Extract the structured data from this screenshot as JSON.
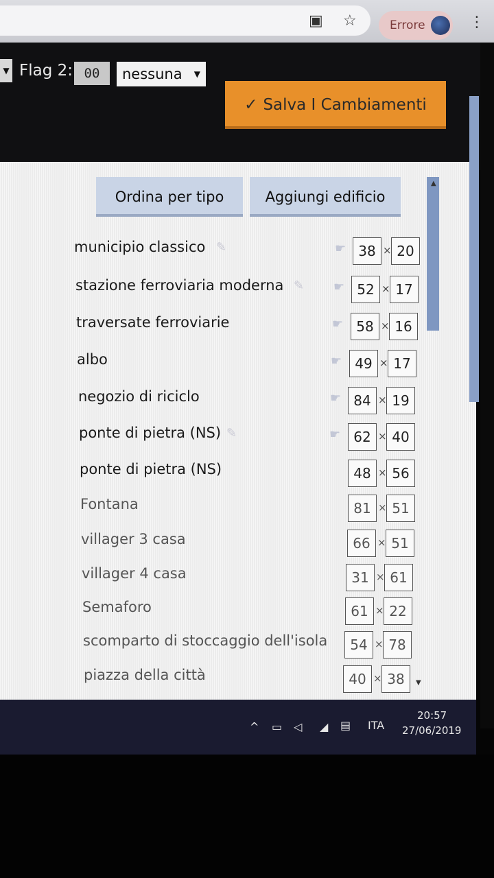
{
  "browser": {
    "error_label": "Errore"
  },
  "header": {
    "flag_label": "Flag 2:",
    "flag_code": "00",
    "flag_select_value": "nessuna",
    "save_button": "Salva I Cambiamenti"
  },
  "toolbar": {
    "sort_button": "Ordina per tipo",
    "add_button": "Aggiungi edificio"
  },
  "buildings": [
    {
      "name": "municipio classico",
      "w": "38",
      "h": "20"
    },
    {
      "name": "stazione ferroviaria moderna",
      "w": "52",
      "h": "17"
    },
    {
      "name": "traversate ferroviarie",
      "w": "58",
      "h": "16"
    },
    {
      "name": "albo",
      "w": "49",
      "h": "17"
    },
    {
      "name": "negozio di riciclo",
      "w": "84",
      "h": "19"
    },
    {
      "name": "ponte di pietra (NS)",
      "w": "62",
      "h": "40"
    },
    {
      "name": "ponte di pietra (NS)",
      "w": "48",
      "h": "56"
    },
    {
      "name": "Fontana",
      "w": "81",
      "h": "51"
    },
    {
      "name": "villager 3 casa",
      "w": "66",
      "h": "51"
    },
    {
      "name": "villager 4 casa",
      "w": "31",
      "h": "61"
    },
    {
      "name": "Semaforo",
      "w": "61",
      "h": "22"
    },
    {
      "name": "scomparto di stoccaggio dell'isola",
      "w": "54",
      "h": "78"
    },
    {
      "name": "piazza della città",
      "w": "40",
      "h": "38"
    }
  ],
  "taskbar": {
    "language": "ITA",
    "time": "20:57",
    "date": "27/06/2019"
  },
  "colors": {
    "accent_button": "#e8902a",
    "toolbar_button": "#c9d4e6",
    "taskbar": "#1a1b30"
  }
}
